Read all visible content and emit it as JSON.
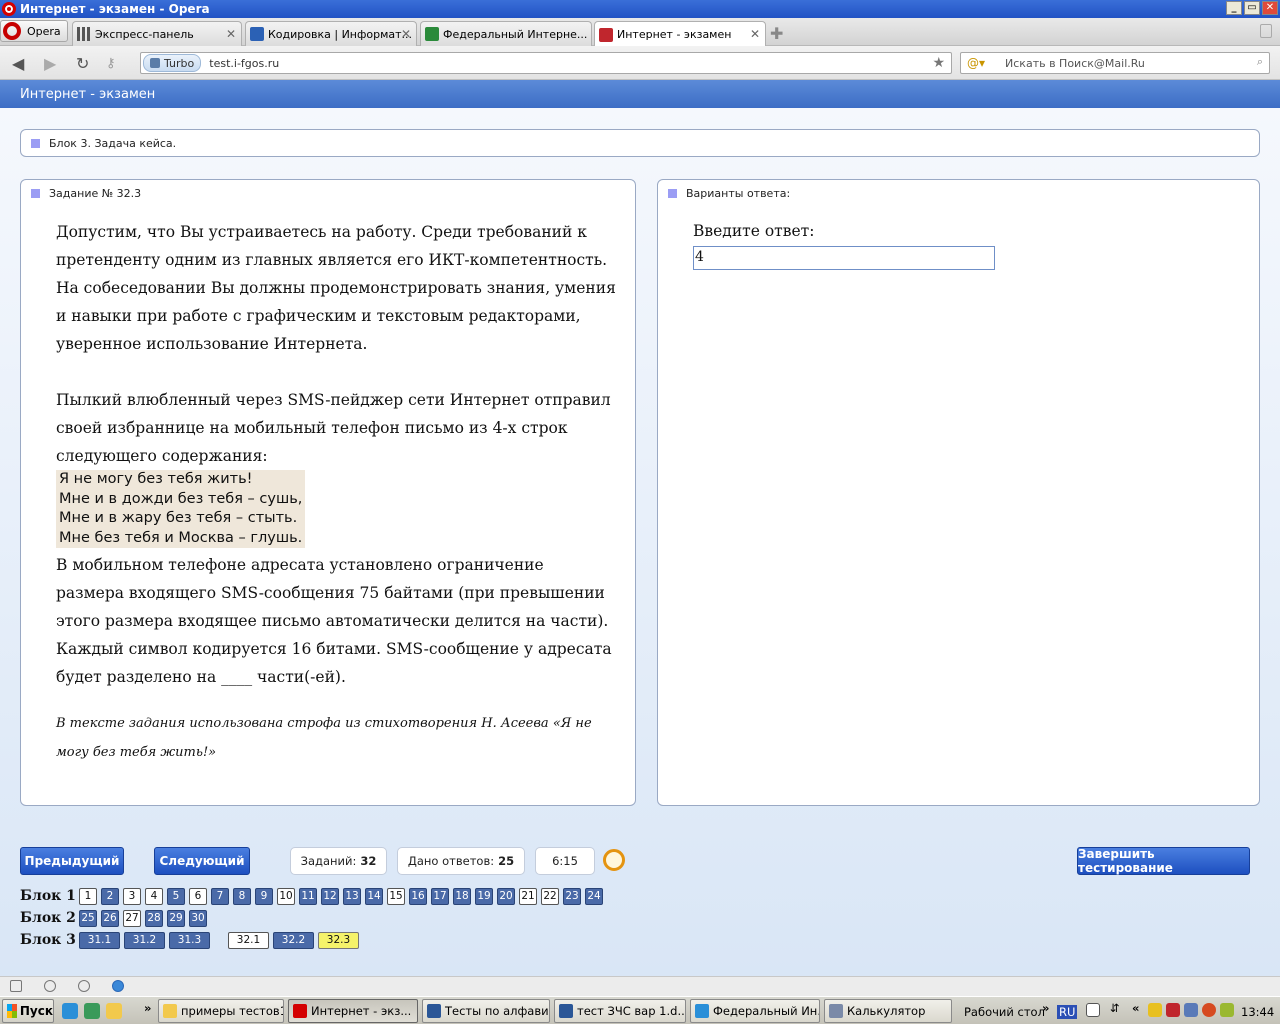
{
  "window": {
    "title": "Интернет - экзамен - Opera",
    "buttons": [
      "_",
      "▭",
      "✕"
    ]
  },
  "browser": {
    "menu_label": "Opera",
    "tabs": [
      {
        "label": "Экспресс-панель",
        "icon": "grid-icon"
      },
      {
        "label": "Кодировка | Информат...",
        "icon": "site-icon"
      },
      {
        "label": "Федеральный Интерне...",
        "icon": "site-icon"
      },
      {
        "label": "Интернет - экзамен",
        "icon": "site-icon"
      }
    ],
    "turbo_label": "Turbo",
    "url": "test.i-fgos.ru",
    "search_placeholder": "Искать в Поиск@Mail.Ru"
  },
  "page": {
    "header_title": "Интернет - экзамен",
    "block_title": "Блок 3. Задача кейса.",
    "task_title": "Задание № 32.3",
    "question_paragraphs": [
      "Допустим, что Вы устраиваетесь на работу. Среди требований к претенденту одним из главных является его ИКТ-компетентность. На собеседовании Вы должны продемонстрировать знания, умения и навыки при работе с графическим и текстовым редакторами, уверенное использование Интернета.",
      "Пылкий влюбленный через SMS-пейджер сети Интернет отправил своей избраннице на мобильный телефон письмо из 4-х строк следующего содержания:"
    ],
    "poem_lines": [
      "Я не могу без тебя жить!",
      "Мне и в дожди без тебя – сушь,",
      "Мне и в жару без тебя – стыть.",
      "Мне без тебя и Москва – глушь."
    ],
    "question_tail": "В мобильном телефоне адресата установлено ограничение размера входящего SMS-сообщения 75 байтами (при превышении этого размера входящее письмо автоматически делится на части). Каждый символ кодируется 16 битами. SMS-сообщение у адресата будет разделено на ____ части(-ей).",
    "note": "В тексте задания использована строфа из стихотворения Н. Асеева «Я не могу без тебя жить!»",
    "answers_title": "Варианты ответа:",
    "answer_label": "Введите ответ:",
    "answer_value": "4"
  },
  "nav": {
    "prev_label": "Предыдущий",
    "next_label": "Следующий",
    "tasks_label": "Заданий:",
    "tasks_count": "32",
    "answered_label": "Дано ответов:",
    "answered_count": "25",
    "timer": "6:15",
    "finish_label": "Завершить тестирование",
    "blocks": [
      {
        "label": "Блок 1",
        "items": [
          {
            "n": "1",
            "state": "unanswered"
          },
          {
            "n": "2",
            "state": "answered"
          },
          {
            "n": "3",
            "state": "unanswered"
          },
          {
            "n": "4",
            "state": "unanswered"
          },
          {
            "n": "5",
            "state": "answered"
          },
          {
            "n": "6",
            "state": "unanswered"
          },
          {
            "n": "7",
            "state": "answered"
          },
          {
            "n": "8",
            "state": "answered"
          },
          {
            "n": "9",
            "state": "answered"
          },
          {
            "n": "10",
            "state": "unanswered"
          },
          {
            "n": "11",
            "state": "answered"
          },
          {
            "n": "12",
            "state": "answered"
          },
          {
            "n": "13",
            "state": "answered"
          },
          {
            "n": "14",
            "state": "answered"
          },
          {
            "n": "15",
            "state": "unanswered"
          },
          {
            "n": "16",
            "state": "answered"
          },
          {
            "n": "17",
            "state": "answered"
          },
          {
            "n": "18",
            "state": "answered"
          },
          {
            "n": "19",
            "state": "answered"
          },
          {
            "n": "20",
            "state": "answered"
          },
          {
            "n": "21",
            "state": "unanswered"
          },
          {
            "n": "22",
            "state": "unanswered"
          },
          {
            "n": "23",
            "state": "answered"
          },
          {
            "n": "24",
            "state": "answered"
          }
        ]
      },
      {
        "label": "Блок 2",
        "items": [
          {
            "n": "25",
            "state": "answered"
          },
          {
            "n": "26",
            "state": "answered"
          },
          {
            "n": "27",
            "state": "unanswered"
          },
          {
            "n": "28",
            "state": "answered"
          },
          {
            "n": "29",
            "state": "answered"
          },
          {
            "n": "30",
            "state": "answered"
          }
        ]
      },
      {
        "label": "Блок 3",
        "items": [
          {
            "n": "31.1",
            "state": "answered"
          },
          {
            "n": "31.2",
            "state": "answered"
          },
          {
            "n": "31.3",
            "state": "answered"
          },
          {
            "n": "32.1",
            "state": "unanswered"
          },
          {
            "n": "32.2",
            "state": "answered"
          },
          {
            "n": "32.3",
            "state": "current"
          }
        ]
      }
    ]
  },
  "taskbar": {
    "start_label": "Пуск",
    "tasks": [
      {
        "label": "примеры тестов1",
        "icon": "folder-icon",
        "color": "#f2c94c"
      },
      {
        "label": "Интернет - экз...",
        "icon": "opera-icon",
        "color": "#d40000"
      },
      {
        "label": "Тесты по алфави...",
        "icon": "word-icon",
        "color": "#2b5797"
      },
      {
        "label": "тест ЗЧС вар 1.d...",
        "icon": "word-icon",
        "color": "#2b5797"
      },
      {
        "label": "Федеральный Ин...",
        "icon": "ie-icon",
        "color": "#2a8fd8"
      },
      {
        "label": "Калькулятор",
        "icon": "calculator-icon",
        "color": "#7a8aa8"
      }
    ],
    "desktop_label": "Рабочий стол",
    "lang": "RU",
    "clock": "13:44"
  }
}
